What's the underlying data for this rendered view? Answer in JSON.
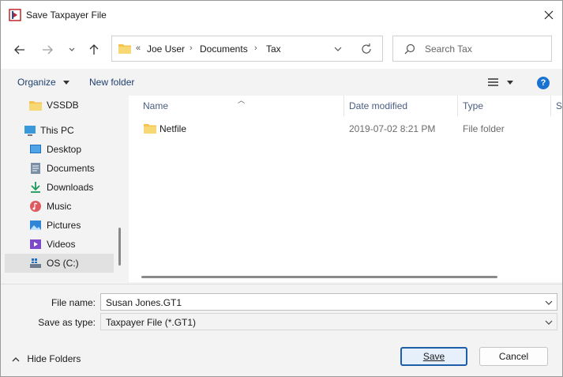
{
  "window": {
    "title": "Save Taxpayer File",
    "close_label": "Close"
  },
  "navigation": {
    "back": "Back",
    "forward": "Forward",
    "recent": "Recent locations",
    "up": "Up"
  },
  "address": {
    "overflow": "«",
    "crumbs": [
      "Joe User",
      "Documents",
      "Tax"
    ]
  },
  "search": {
    "placeholder": "Search Tax"
  },
  "commands": {
    "organize": "Organize",
    "new_folder": "New folder",
    "help": "?"
  },
  "nav_pane": {
    "items": [
      {
        "label": "VSSDB",
        "icon": "folder-icon"
      },
      {
        "label": "This PC",
        "icon": "computer-icon"
      },
      {
        "label": "Desktop",
        "icon": "desktop-icon"
      },
      {
        "label": "Documents",
        "icon": "documents-icon"
      },
      {
        "label": "Downloads",
        "icon": "download-icon"
      },
      {
        "label": "Music",
        "icon": "music-icon"
      },
      {
        "label": "Pictures",
        "icon": "pictures-icon"
      },
      {
        "label": "Videos",
        "icon": "videos-icon"
      },
      {
        "label": "OS (C:)",
        "icon": "drive-icon"
      }
    ],
    "selected": "OS (C:)"
  },
  "file_list": {
    "columns": [
      "Name",
      "Date modified",
      "Type",
      "S"
    ],
    "rows": [
      {
        "name": "Netfile",
        "date_modified": "2019-07-02 8:21 PM",
        "type": "File folder"
      }
    ]
  },
  "form": {
    "file_name_label": "File name:",
    "file_name_underline": "n",
    "file_name_value": "Susan Jones.GT1",
    "save_as_type_label": "Save as type:",
    "save_as_type_value": "Taxpayer File (*.GT1)"
  },
  "footer": {
    "hide_folders": "Hide Folders",
    "save": "Save",
    "cancel": "Cancel"
  },
  "colors": {
    "accent": "#1a73d1",
    "folder": "#f4c44e",
    "primary_border": "#1f5ea8"
  }
}
